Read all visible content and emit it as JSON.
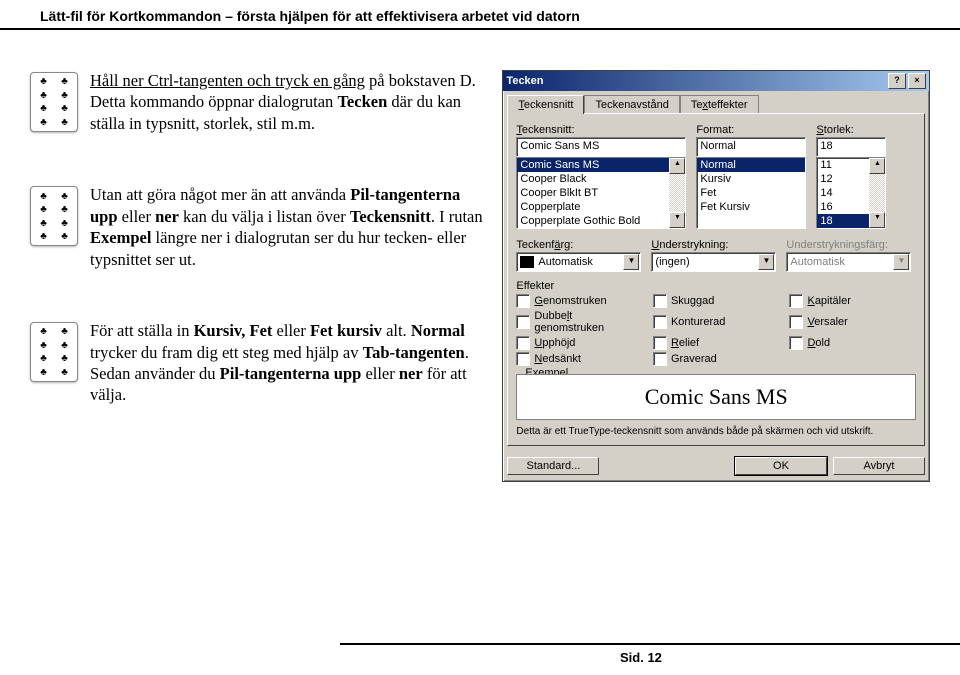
{
  "header": "Lätt-fil för Kortkommandon – första hjälpen för att effektivisera arbetet vid datorn",
  "blocks": {
    "b1_pre": "Håll ner Ctrl-tangenten och tryck en gång",
    "b1_post1": " på bokstaven D. Detta kommando öppnar dialogrutan ",
    "b1_bold1": "Tecken",
    "b1_post2": " där du kan ställa in typsnitt, storlek, stil m.m.",
    "b2_pre": "Utan att göra något mer än att använda ",
    "b2_bold1": "Pil-tangenterna upp",
    "b2_mid1": " eller ",
    "b2_bold2": "ner",
    "b2_mid2": " kan du välja i listan över ",
    "b2_bold3": "Teckensnitt",
    "b2_mid3": ". I rutan ",
    "b2_bold4": "Exempel",
    "b2_post": " längre ner i dialogrutan ser du hur tecken- eller typsnittet ser ut.",
    "b3_pre": "För att ställa in ",
    "b3_bold1": "Kursiv, Fet",
    "b3_mid1": " eller ",
    "b3_bold2": "Fet kursiv",
    "b3_mid2": " alt. ",
    "b3_bold3": "Normal",
    "b3_mid3": " trycker du fram dig ett steg med hjälp av ",
    "b3_bold4": "Tab-tangenten",
    "b3_mid4": ". Sedan använder du ",
    "b3_bold5": "Pil-tangenterna upp",
    "b3_mid5": " eller ",
    "b3_bold6": "ner",
    "b3_post": " för att välja."
  },
  "dialog": {
    "title": "Tecken",
    "help": "?",
    "close": "×",
    "tabs": [
      "Teckensnitt",
      "Teckenavstånd",
      "Texteffekter"
    ],
    "tab_acc": [
      "T",
      "",
      "x"
    ],
    "labels": {
      "font": "Teckensnitt:",
      "format": "Format:",
      "size": "Storlek:",
      "fontcolor": "Teckenfärg:",
      "underline": "Understrykning:",
      "ulcolor": "Understrykningsfärg:",
      "effects": "Effekter",
      "example": "Exempel"
    },
    "font_value": "Comic Sans MS",
    "font_list": [
      "Comic Sans MS",
      "Cooper Black",
      "Cooper BlkIt BT",
      "Copperplate",
      "Copperplate Gothic Bold"
    ],
    "format_value": "Normal",
    "format_list": [
      "Normal",
      "Kursiv",
      "Fet",
      "Fet Kursiv"
    ],
    "size_value": "18",
    "size_list": [
      "11",
      "12",
      "14",
      "16",
      "18"
    ],
    "fontcolor_value": "Automatisk",
    "underline_value": "(ingen)",
    "ulcolor_value": "Automatisk",
    "effects_list": [
      {
        "label": "Genomstruken",
        "acc": "G"
      },
      {
        "label": "Dubbelt genomstruken",
        "acc": "l"
      },
      {
        "label": "Upphöjd",
        "acc": "U"
      },
      {
        "label": "Nedsänkt",
        "acc": "N"
      },
      {
        "label": "Skuggad",
        "acc": ""
      },
      {
        "label": "Konturerad",
        "acc": ""
      },
      {
        "label": "Relief",
        "acc": "R"
      },
      {
        "label": "Graverad",
        "acc": ""
      },
      {
        "label": "Kapitäler",
        "acc": "K"
      },
      {
        "label": "Versaler",
        "acc": "V"
      },
      {
        "label": "Dold",
        "acc": "D"
      }
    ],
    "example_text": "Comic Sans MS",
    "desc": "Detta är ett TrueType-teckensnitt som används både på skärmen och vid utskrift.",
    "buttons": {
      "default": "Standard...",
      "ok": "OK",
      "cancel": "Avbryt"
    }
  },
  "footer": "Sid. 12"
}
